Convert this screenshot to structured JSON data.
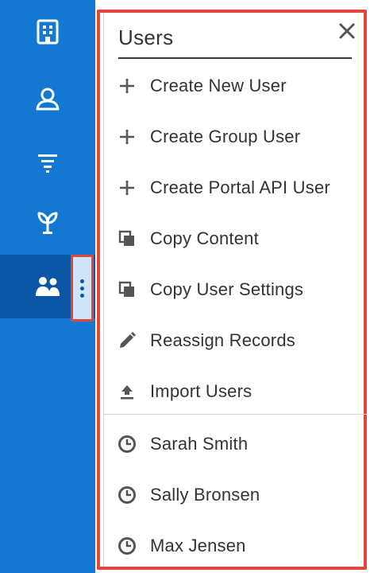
{
  "sidebar": {
    "background": "#1378d1",
    "active_background": "#0b56a6",
    "items": [
      {
        "icon": "building-icon"
      },
      {
        "icon": "contact-icon"
      },
      {
        "icon": "funnel-icon"
      },
      {
        "icon": "sprout-icon"
      },
      {
        "icon": "users-icon",
        "active": true
      }
    ],
    "kebab_icon": "kebab-menu-icon"
  },
  "panel": {
    "title": "Users",
    "close_icon": "close-icon",
    "highlight_color": "#e0463c",
    "actions": [
      {
        "label": "Create New User",
        "icon": "plus-icon"
      },
      {
        "label": "Create Group User",
        "icon": "plus-icon"
      },
      {
        "label": "Create Portal API User",
        "icon": "plus-icon"
      },
      {
        "label": "Copy Content",
        "icon": "copy-icon"
      },
      {
        "label": "Copy User Settings",
        "icon": "copy-icon"
      },
      {
        "label": "Reassign Records",
        "icon": "pencil-icon"
      },
      {
        "label": "Import Users",
        "icon": "upload-icon"
      }
    ],
    "recent": [
      {
        "label": "Sarah Smith",
        "icon": "clock-icon"
      },
      {
        "label": "Sally Bronsen",
        "icon": "clock-icon"
      },
      {
        "label": "Max Jensen",
        "icon": "clock-icon"
      }
    ]
  }
}
